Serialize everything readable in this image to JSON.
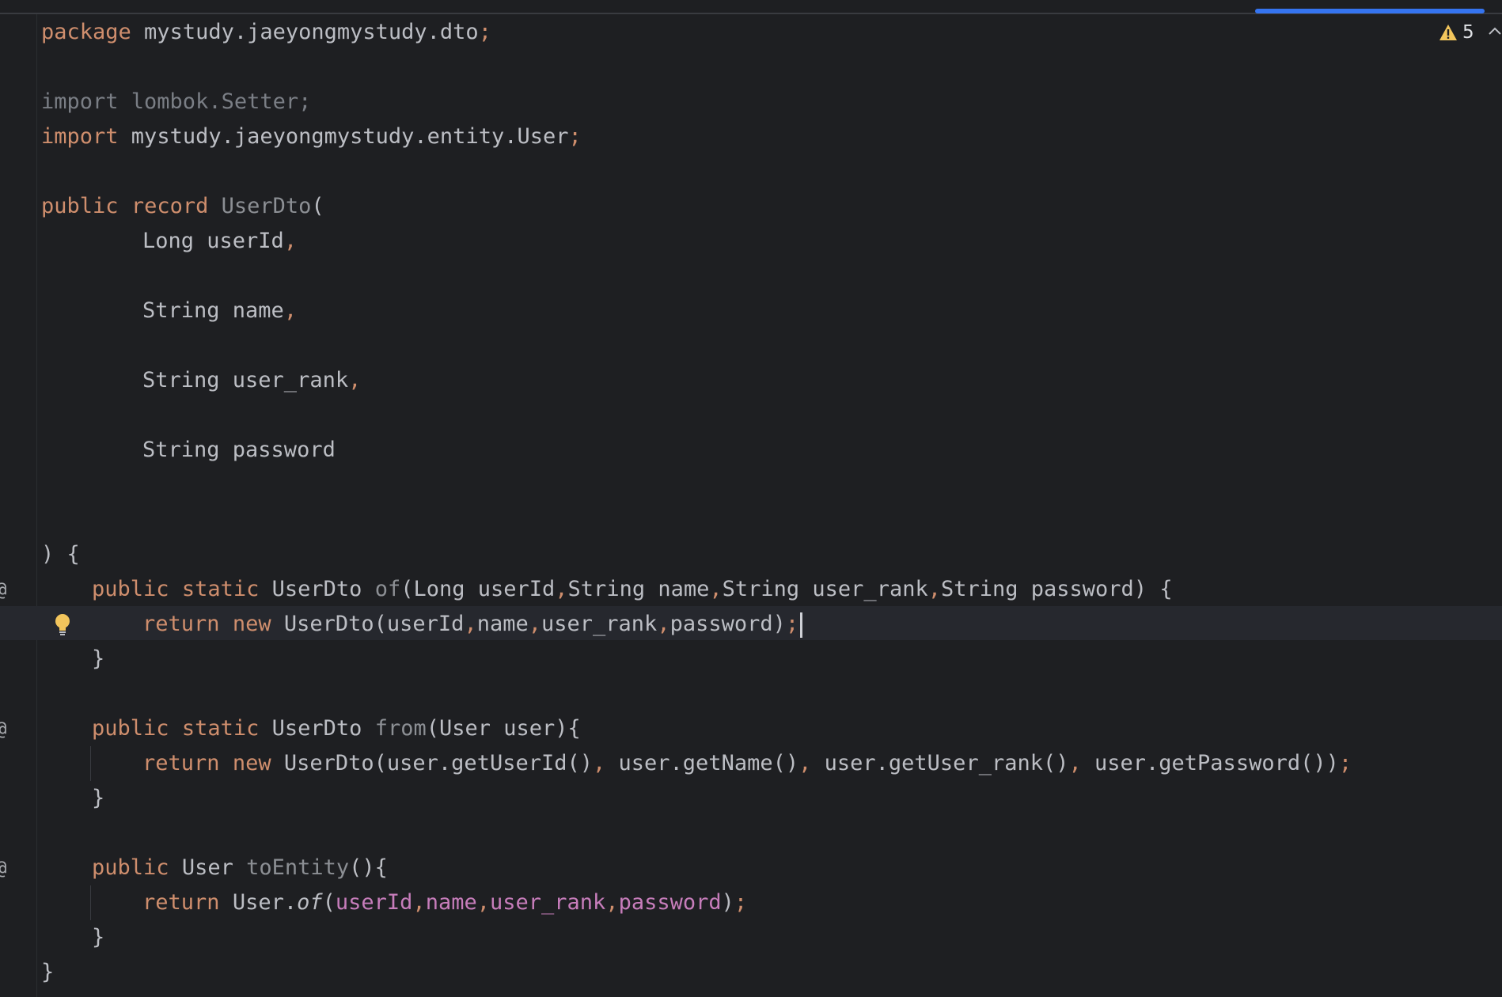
{
  "status": {
    "warning_count": "5"
  },
  "colors": {
    "background": "#1e1f22",
    "keyword": "#cf8e6d",
    "text": "#bcbec4",
    "dim": "#7a7e85",
    "field": "#c77dbb",
    "progress": "#3574f0",
    "warning": "#f2c55c"
  },
  "icons": {
    "warning": "warning-triangle-icon",
    "bulb": "lightbulb-icon",
    "override": "at-sign-icon",
    "chevron": "chevron-up-icon"
  },
  "code": {
    "l1": {
      "kw": "package",
      "rest": " mystudy.jaeyongmystudy.dto",
      "semi": ";"
    },
    "l3": {
      "text": "import lombok.Setter;"
    },
    "l4": {
      "kw": "import",
      "rest": " mystudy.jaeyongmystudy.entity.User",
      "semi": ";"
    },
    "l6": {
      "kw1": "public",
      "kw2": "record",
      "name": "UserDto",
      "paren": "("
    },
    "l7": {
      "text": "Long userId",
      "comma": ","
    },
    "l9": {
      "text": "String name",
      "comma": ","
    },
    "l11": {
      "text": "String user_rank",
      "comma": ","
    },
    "l13": {
      "text": "String password"
    },
    "l16": {
      "text": ") {"
    },
    "l17": {
      "gutter": "@",
      "kw1": "public",
      "kw2": "static",
      "type": "UserDto",
      "fn": "of",
      "p1": "(Long userId",
      "c1": ",",
      "p2": "String name",
      "c2": ",",
      "p3": "String user_rank",
      "c3": ",",
      "p4": "String password) {"
    },
    "l18": {
      "kw1": "return",
      "kw2": "new",
      "call": "UserDto(userId",
      "c1": ",",
      "a2": "name",
      "c2": ",",
      "a3": "user_rank",
      "c3": ",",
      "a4": "password)",
      "semi": ";"
    },
    "l19": {
      "text": "}"
    },
    "l21": {
      "gutter": "@",
      "kw1": "public",
      "kw2": "static",
      "type": "UserDto",
      "fn": "from",
      "rest": "(User user){"
    },
    "l22": {
      "kw1": "return",
      "kw2": "new",
      "call": "UserDto(user.getUserId()",
      "c1": ",",
      "a2": " user.getName()",
      "c2": ",",
      "a3": " user.getUser_rank()",
      "c3": ",",
      "a4": " user.getPassword())",
      "semi": ";"
    },
    "l23": {
      "text": "}"
    },
    "l25": {
      "gutter": "@",
      "kw1": "public",
      "type": "User",
      "fn": "toEntity",
      "rest": "(){"
    },
    "l26": {
      "kw1": "return",
      "pre": "User.",
      "fn": "of",
      "open": "(",
      "f1": "userId",
      "c1": ",",
      "f2": "name",
      "c2": ",",
      "f3": "user_rank",
      "c3": ",",
      "f4": "password",
      "close": ")",
      "semi": ";"
    },
    "l27": {
      "text": "}"
    },
    "l28": {
      "text": "}"
    }
  }
}
